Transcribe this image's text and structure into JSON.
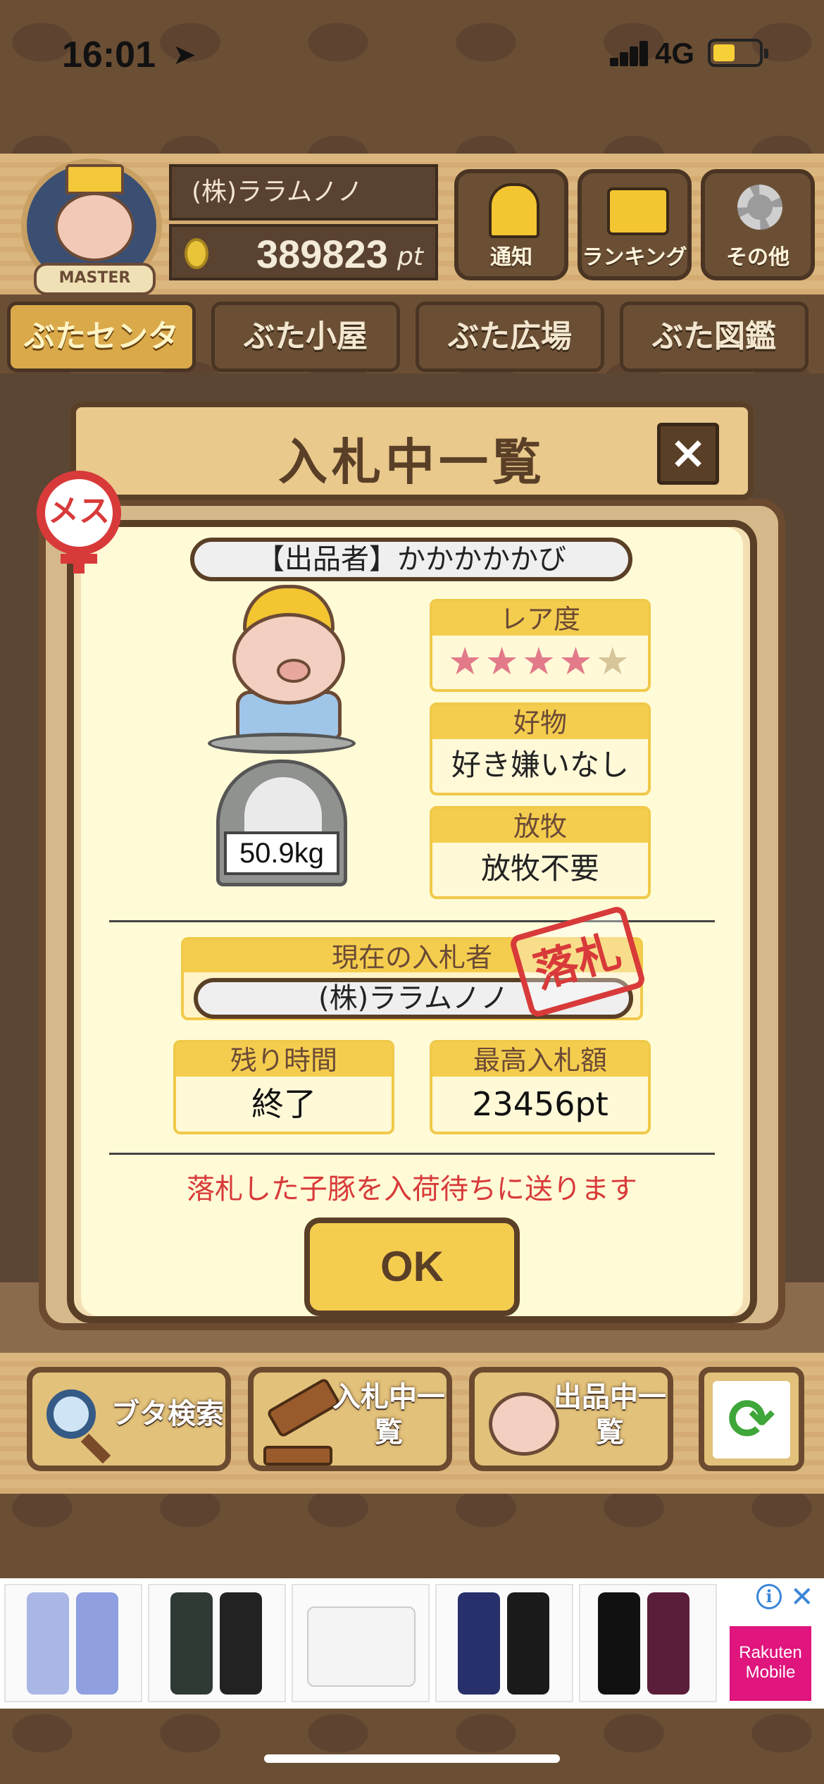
{
  "status_bar": {
    "time": "16:01",
    "network": "4G"
  },
  "header": {
    "badge_text": "MASTER",
    "company_name": "(株)ララムノノ",
    "points_value": "389823",
    "points_unit": "pt",
    "buttons": [
      {
        "label": "通知",
        "icon": "bell-icon"
      },
      {
        "label": "ランキング",
        "icon": "crown-icon"
      },
      {
        "label": "その他",
        "icon": "gear-icon"
      }
    ]
  },
  "tabs": [
    {
      "label": "ぶたセンター",
      "active": true
    },
    {
      "label": "ぶた小屋",
      "active": false
    },
    {
      "label": "ぶた広場",
      "active": false
    },
    {
      "label": "ぶた図鑑",
      "active": false
    }
  ],
  "modal": {
    "title": "入札中一覧",
    "close_label": "×",
    "gender_badge": "メス",
    "seller": "【出品者】かかかかかび",
    "weight": "50.9kg",
    "rarity": {
      "label": "レア度",
      "stars_filled": 4,
      "stars_total": 5
    },
    "favorite": {
      "label": "好物",
      "value": "好き嫌いなし"
    },
    "pasture": {
      "label": "放牧",
      "value": "放牧不要"
    },
    "current_bidder": {
      "label": "現在の入札者",
      "value": "(株)ララムノノ"
    },
    "won_stamp": "落札",
    "time_left": {
      "label": "残り時間",
      "value": "終了"
    },
    "highest_bid": {
      "label": "最高入札額",
      "value": "23456pt"
    },
    "notice": "落札した子豚を入荷待ちに送ります",
    "ok_label": "OK"
  },
  "bottom_buttons": [
    {
      "label": "ブタ検索",
      "icon": "magnifier-icon"
    },
    {
      "label": "入札中一覧",
      "icon": "gavel-icon"
    },
    {
      "label": "出品中一覧",
      "icon": "pig-face-icon"
    }
  ],
  "refresh_icon": "refresh-icon",
  "ad": {
    "brand_line1": "Rakuten",
    "brand_line2": "Mobile",
    "info": "i",
    "close": "✕",
    "accent": "#e0157d"
  }
}
